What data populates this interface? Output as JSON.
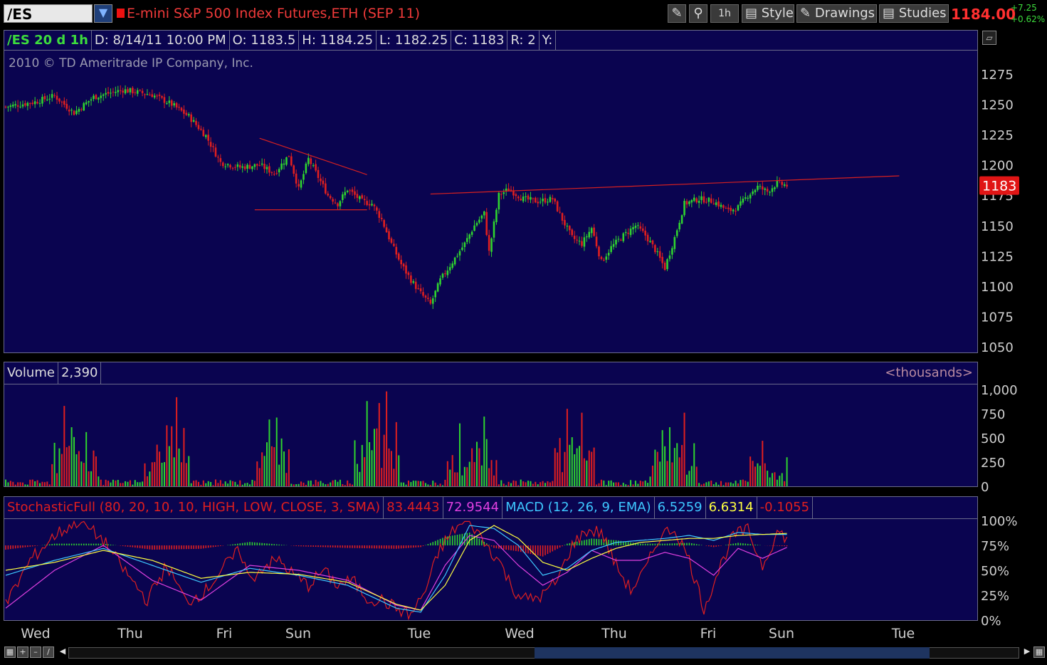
{
  "toolbar": {
    "symbol": "/ES",
    "title": "E-mini S&P 500 Index Futures,ETH (SEP 11)",
    "timeframe_button": "1h",
    "style_label": "Style",
    "drawings_label": "Drawings",
    "studies_label": "Studies",
    "last_price": "1184.00",
    "change_abs": "+7.25",
    "change_pct": "+0.62%"
  },
  "price_header": {
    "symbol_period": "/ES 20 d 1h",
    "date": "D: 8/14/11 10:00 PM",
    "open": "O: 1183.5",
    "high": "H: 1184.25",
    "low": "L: 1182.25",
    "close": "C: 1183",
    "range": "R: 2",
    "y": "Y:"
  },
  "copyright": "2010 © TD Ameritrade IP Company, Inc.",
  "price_badge": "1183",
  "volume_header": {
    "label": "Volume",
    "value": "2,390",
    "units": "<thousands>"
  },
  "study_header": {
    "stoch_label": "StochasticFull (80, 20, 10, 10, HIGH, LOW, CLOSE, 3, SMA)",
    "stoch_k": "83.4443",
    "stoch_d": "72.9544",
    "macd_label": "MACD (12, 26, 9, EMA)",
    "macd_value": "6.5259",
    "macd_avg": "6.6314",
    "macd_diff": "-0.1055"
  },
  "colors": {
    "up": "#2fd42f",
    "down": "#e01f1f",
    "background": "#0a0450",
    "stoch_k": "#e01f1f",
    "stoch_d": "#e040e0",
    "macd": "#3ec8ff",
    "macd_avg": "#ffff40"
  },
  "chart_data": [
    {
      "type": "candlestick",
      "title": "/ES 20 d 1h",
      "ylim": [
        1045,
        1290
      ],
      "yticks": [
        1050,
        1075,
        1100,
        1125,
        1150,
        1175,
        1200,
        1225,
        1250,
        1275
      ],
      "xticks": [
        "Wed",
        "Thu",
        "Fri",
        "Sun",
        "Tue",
        "Wed",
        "Thu",
        "Fri",
        "Sun",
        "Tue"
      ],
      "close_path": [
        [
          0,
          1248
        ],
        [
          12,
          1252
        ],
        [
          20,
          1257
        ],
        [
          28,
          1243
        ],
        [
          36,
          1256
        ],
        [
          48,
          1262
        ],
        [
          60,
          1258
        ],
        [
          68,
          1250
        ],
        [
          75,
          1240
        ],
        [
          82,
          1224
        ],
        [
          88,
          1202
        ],
        [
          96,
          1198
        ],
        [
          104,
          1200
        ],
        [
          110,
          1193
        ],
        [
          116,
          1208
        ],
        [
          120,
          1180
        ],
        [
          124,
          1205
        ],
        [
          128,
          1190
        ],
        [
          132,
          1175
        ],
        [
          136,
          1168
        ],
        [
          140,
          1180
        ],
        [
          146,
          1170
        ],
        [
          150,
          1168
        ],
        [
          154,
          1155
        ],
        [
          158,
          1135
        ],
        [
          162,
          1118
        ],
        [
          166,
          1105
        ],
        [
          170,
          1094
        ],
        [
          174,
          1085
        ],
        [
          178,
          1105
        ],
        [
          183,
          1120
        ],
        [
          188,
          1135
        ],
        [
          192,
          1150
        ],
        [
          196,
          1160
        ],
        [
          198,
          1128
        ],
        [
          202,
          1175
        ],
        [
          206,
          1180
        ],
        [
          212,
          1172
        ],
        [
          218,
          1170
        ],
        [
          224,
          1172
        ],
        [
          228,
          1155
        ],
        [
          232,
          1140
        ],
        [
          236,
          1135
        ],
        [
          240,
          1148
        ],
        [
          244,
          1120
        ],
        [
          248,
          1132
        ],
        [
          252,
          1140
        ],
        [
          258,
          1150
        ],
        [
          262,
          1142
        ],
        [
          266,
          1130
        ],
        [
          270,
          1115
        ],
        [
          274,
          1140
        ],
        [
          278,
          1168
        ],
        [
          284,
          1172
        ],
        [
          290,
          1170
        ],
        [
          296,
          1162
        ],
        [
          300,
          1165
        ],
        [
          304,
          1175
        ],
        [
          308,
          1182
        ],
        [
          312,
          1178
        ],
        [
          316,
          1185
        ],
        [
          320,
          1183
        ]
      ],
      "trendlines": [
        {
          "from": [
            104,
            1222
          ],
          "to": [
            148,
            1192
          ]
        },
        {
          "from": [
            102,
            1163
          ],
          "to": [
            148,
            1163
          ]
        },
        {
          "from": [
            174,
            1176
          ],
          "to": [
            366,
            1191
          ]
        }
      ],
      "last": 1183
    },
    {
      "type": "bar",
      "title": "Volume",
      "units": "thousands",
      "ylim": [
        0,
        1000
      ],
      "yticks": [
        0,
        250,
        500,
        750,
        1000
      ],
      "spikes": [
        [
          24,
          830,
          "down"
        ],
        [
          27,
          610,
          "up"
        ],
        [
          33,
          560,
          "up"
        ],
        [
          62,
          430,
          "down"
        ],
        [
          68,
          620,
          "down"
        ],
        [
          70,
          920,
          "down"
        ],
        [
          108,
          690,
          "up"
        ],
        [
          111,
          710,
          "up"
        ],
        [
          148,
          880,
          "up"
        ],
        [
          153,
          860,
          "down"
        ],
        [
          156,
          980,
          "down"
        ],
        [
          186,
          650,
          "up"
        ],
        [
          196,
          720,
          "up"
        ],
        [
          230,
          800,
          "down"
        ],
        [
          236,
          760,
          "down"
        ],
        [
          269,
          580,
          "up"
        ],
        [
          272,
          610,
          "up"
        ],
        [
          278,
          760,
          "down"
        ],
        [
          310,
          470,
          "down"
        ],
        [
          320,
          300,
          "up"
        ]
      ]
    },
    {
      "type": "line",
      "title": "StochasticFull / MACD",
      "ylim": [
        0,
        100
      ],
      "yticks": [
        "0%",
        "25%",
        "50%",
        "75%",
        "100%"
      ],
      "series": [
        {
          "name": "StochasticFull %K",
          "values": [
            [
              0,
              15
            ],
            [
              10,
              60
            ],
            [
              20,
              85
            ],
            [
              30,
              100
            ],
            [
              40,
              80
            ],
            [
              50,
              45
            ],
            [
              58,
              20
            ],
            [
              66,
              55
            ],
            [
              74,
              18
            ],
            [
              82,
              30
            ],
            [
              90,
              55
            ],
            [
              96,
              70
            ],
            [
              100,
              40
            ],
            [
              106,
              55
            ],
            [
              112,
              60
            ],
            [
              118,
              45
            ],
            [
              124,
              35
            ],
            [
              130,
              50
            ],
            [
              136,
              35
            ],
            [
              142,
              40
            ],
            [
              148,
              22
            ],
            [
              154,
              20
            ],
            [
              160,
              12
            ],
            [
              166,
              5
            ],
            [
              172,
              30
            ],
            [
              178,
              72
            ],
            [
              184,
              92
            ],
            [
              190,
              100
            ],
            [
              196,
              78
            ],
            [
              202,
              60
            ],
            [
              208,
              30
            ],
            [
              214,
              20
            ],
            [
              220,
              25
            ],
            [
              226,
              40
            ],
            [
              232,
              75
            ],
            [
              238,
              90
            ],
            [
              244,
              88
            ],
            [
              250,
              55
            ],
            [
              256,
              30
            ],
            [
              262,
              50
            ],
            [
              268,
              85
            ],
            [
              274,
              92
            ],
            [
              280,
              60
            ],
            [
              286,
              12
            ],
            [
              292,
              50
            ],
            [
              298,
              85
            ],
            [
              304,
              90
            ],
            [
              310,
              55
            ],
            [
              316,
              88
            ],
            [
              320,
              83
            ]
          ]
        },
        {
          "name": "StochasticFull %D",
          "values": [
            [
              0,
              12
            ],
            [
              20,
              50
            ],
            [
              40,
              75
            ],
            [
              60,
              40
            ],
            [
              80,
              20
            ],
            [
              100,
              55
            ],
            [
              120,
              50
            ],
            [
              140,
              40
            ],
            [
              160,
              15
            ],
            [
              170,
              10
            ],
            [
              180,
              55
            ],
            [
              190,
              85
            ],
            [
              200,
              80
            ],
            [
              210,
              55
            ],
            [
              220,
              35
            ],
            [
              230,
              48
            ],
            [
              240,
              70
            ],
            [
              250,
              60
            ],
            [
              260,
              60
            ],
            [
              270,
              68
            ],
            [
              280,
              62
            ],
            [
              290,
              45
            ],
            [
              300,
              72
            ],
            [
              310,
              62
            ],
            [
              320,
              73
            ]
          ]
        },
        {
          "name": "MACD",
          "values": [
            [
              0,
              45
            ],
            [
              20,
              60
            ],
            [
              40,
              72
            ],
            [
              60,
              55
            ],
            [
              80,
              38
            ],
            [
              100,
              52
            ],
            [
              120,
              45
            ],
            [
              140,
              35
            ],
            [
              160,
              12
            ],
            [
              170,
              8
            ],
            [
              180,
              45
            ],
            [
              190,
              95
            ],
            [
              200,
              92
            ],
            [
              210,
              75
            ],
            [
              220,
              45
            ],
            [
              230,
              52
            ],
            [
              240,
              70
            ],
            [
              250,
              78
            ],
            [
              260,
              80
            ],
            [
              270,
              82
            ],
            [
              280,
              85
            ],
            [
              290,
              80
            ],
            [
              300,
              88
            ],
            [
              310,
              86
            ],
            [
              320,
              86
            ]
          ]
        },
        {
          "name": "MACD Avg",
          "values": [
            [
              0,
              50
            ],
            [
              20,
              58
            ],
            [
              40,
              70
            ],
            [
              60,
              60
            ],
            [
              80,
              42
            ],
            [
              100,
              48
            ],
            [
              120,
              46
            ],
            [
              140,
              38
            ],
            [
              160,
              16
            ],
            [
              170,
              10
            ],
            [
              180,
              35
            ],
            [
              190,
              80
            ],
            [
              200,
              95
            ],
            [
              210,
              82
            ],
            [
              220,
              58
            ],
            [
              230,
              50
            ],
            [
              240,
              62
            ],
            [
              250,
              72
            ],
            [
              260,
              78
            ],
            [
              270,
              80
            ],
            [
              280,
              82
            ],
            [
              290,
              82
            ],
            [
              300,
              85
            ],
            [
              310,
              86
            ],
            [
              320,
              87
            ]
          ]
        }
      ]
    }
  ]
}
